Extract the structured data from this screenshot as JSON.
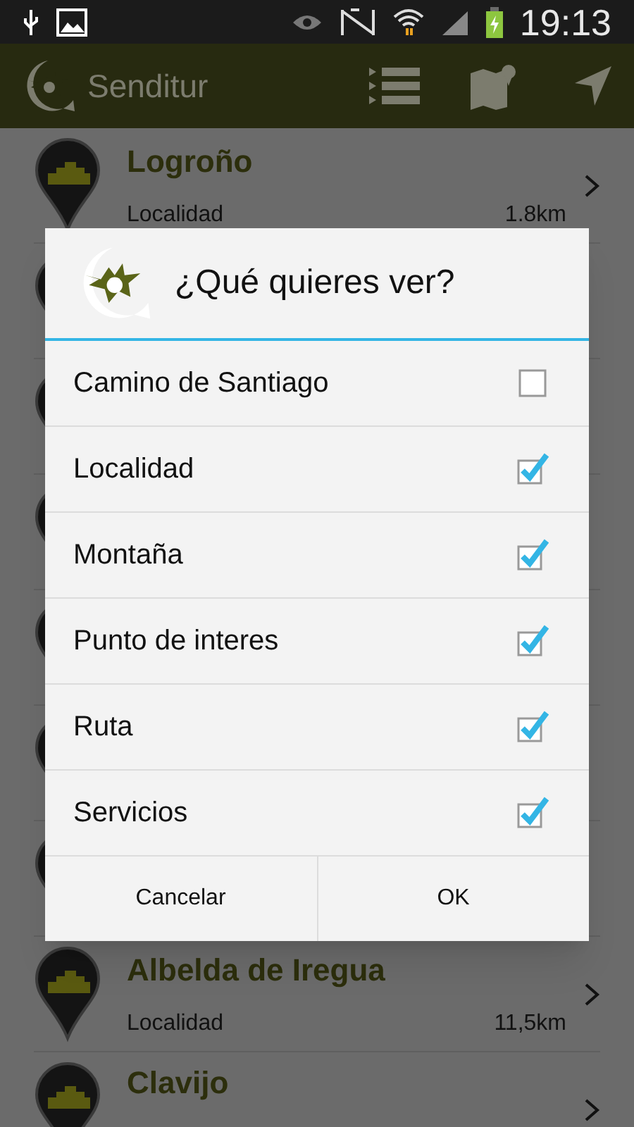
{
  "status_bar": {
    "time": "19:13"
  },
  "app_bar": {
    "title": "Senditur"
  },
  "list": [
    {
      "kind": "place",
      "name": "Logroño",
      "type": "Localidad",
      "distance": "1.8km"
    },
    {
      "kind": "covered"
    },
    {
      "kind": "covered"
    },
    {
      "kind": "covered"
    },
    {
      "kind": "covered"
    },
    {
      "kind": "covered"
    },
    {
      "kind": "covered"
    },
    {
      "kind": "place",
      "name": "Albelda de Iregua",
      "type": "Localidad",
      "distance": "11,5km"
    },
    {
      "kind": "place",
      "name": "Clavijo"
    }
  ],
  "dialog": {
    "title": "¿Qué quieres ver?",
    "options": [
      {
        "label": "Camino de Santiago",
        "checked": false
      },
      {
        "label": "Localidad",
        "checked": true
      },
      {
        "label": "Montaña",
        "checked": true
      },
      {
        "label": "Punto de interes",
        "checked": true
      },
      {
        "label": "Ruta",
        "checked": true
      },
      {
        "label": "Servicios",
        "checked": true
      }
    ],
    "buttons": [
      "Cancelar",
      "OK"
    ]
  }
}
